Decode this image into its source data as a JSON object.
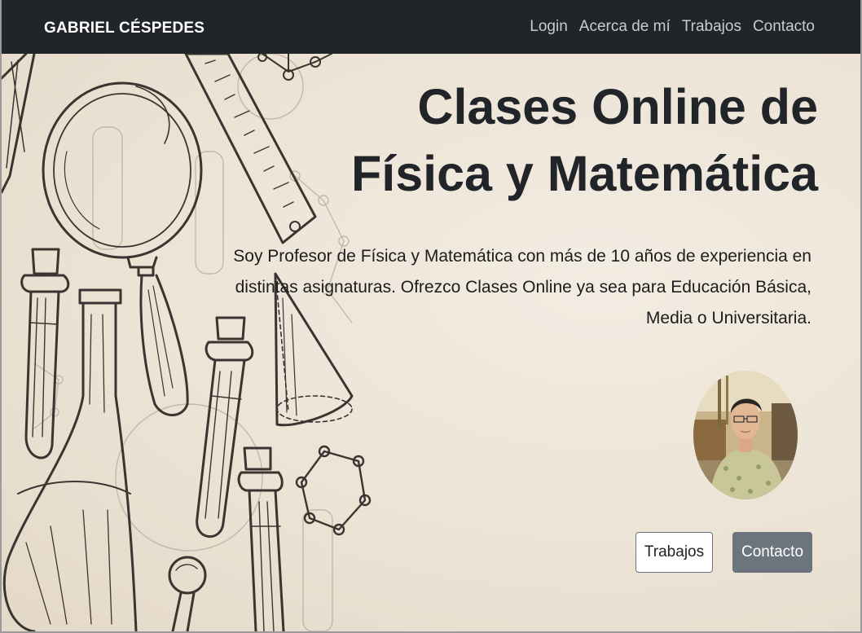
{
  "navbar": {
    "brand": "GABRIEL CÉSPEDES",
    "links": [
      "Login",
      "Acerca de mí",
      "Trabajos",
      "Contacto"
    ]
  },
  "hero": {
    "title_line1": "Clases Online de",
    "title_line2": "Física y Matemática",
    "description": "Soy Profesor de Física y Matemática con más de 10 años de experiencia en distintas asignaturas. Ofrezco Clases Online ya sea para Educación Básica, Media o Universitaria.",
    "buttons": {
      "primary": "Trabajos",
      "secondary": "Contacto"
    }
  },
  "colors": {
    "navbar_bg": "#212529",
    "hero_bg": "#efe6d9",
    "button_secondary": "#6c757d"
  }
}
